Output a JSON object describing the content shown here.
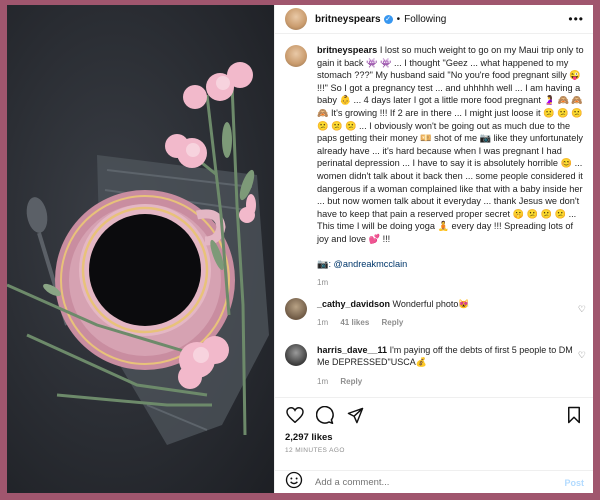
{
  "header": {
    "username": "britneyspears",
    "verified": true,
    "separator": "•",
    "follow_label": "Following",
    "more_label": "•••"
  },
  "caption": {
    "username": "britneyspears",
    "text": "I lost so much weight to go on my Maui trip only to gain it back 👾 👾 ... I thought \"Geez ... what happened to my stomach ???\" My husband said \"No you're food pregnant silly 😜 !!!\" So I got a pregnancy test ... and uhhhhh well ... I am having a baby 👶 ... 4 days later I got a little more food pregnant 🤰 🙈 🙈 🙈 It's growing !!! If 2 are in there ... I might just loose it 😕 😕 😕 😕 😕 😕 ... I obviously won't be going out as much due to the paps getting their money 💴 shot of me 📷 like they unfortunately already have ... it's hard because when I was pregnant I had perinatal depression ... I have to say it is absolutely horrible 😊 ... women didn't talk about it back then ... some people considered it dangerous if a woman complained like that with a baby inside her ... but now women talk about it everyday ... thank Jesus we don't have to keep that pain a reserved proper secret 🤫 😕 😕 😕 ... This time I will be doing yoga 🧘 every day !!! Spreading lots of joy and love 💕 !!!",
    "credit": "📷: @andreakmcclain",
    "time": "1m"
  },
  "comments": [
    {
      "username": "_cathy_davidson",
      "text": "Wonderful photo😻",
      "time": "1m",
      "likes": "41 likes",
      "reply": "Reply",
      "heart": "♡"
    },
    {
      "username": "harris_dave__11",
      "text": "I'm paying off the debts of first 5 people to DM Me DEPRESSED\"USCA💰",
      "time": "1m",
      "reply": "Reply",
      "heart": "♡"
    }
  ],
  "footer": {
    "likes": "2,297 likes",
    "timestamp": "12 MINUTES AGO",
    "comment_placeholder": "Add a comment...",
    "post_label": "Post"
  },
  "colors": {
    "page_background": "#a0566e",
    "verified": "#3897f0",
    "post_button": "#b3dbff",
    "heart_red": "#ed4956"
  },
  "icons": [
    "verified-badge-icon",
    "more-options-icon",
    "heart-icon",
    "comment-icon",
    "share-icon",
    "bookmark-icon",
    "emoji-icon",
    "comment-like-icon"
  ]
}
